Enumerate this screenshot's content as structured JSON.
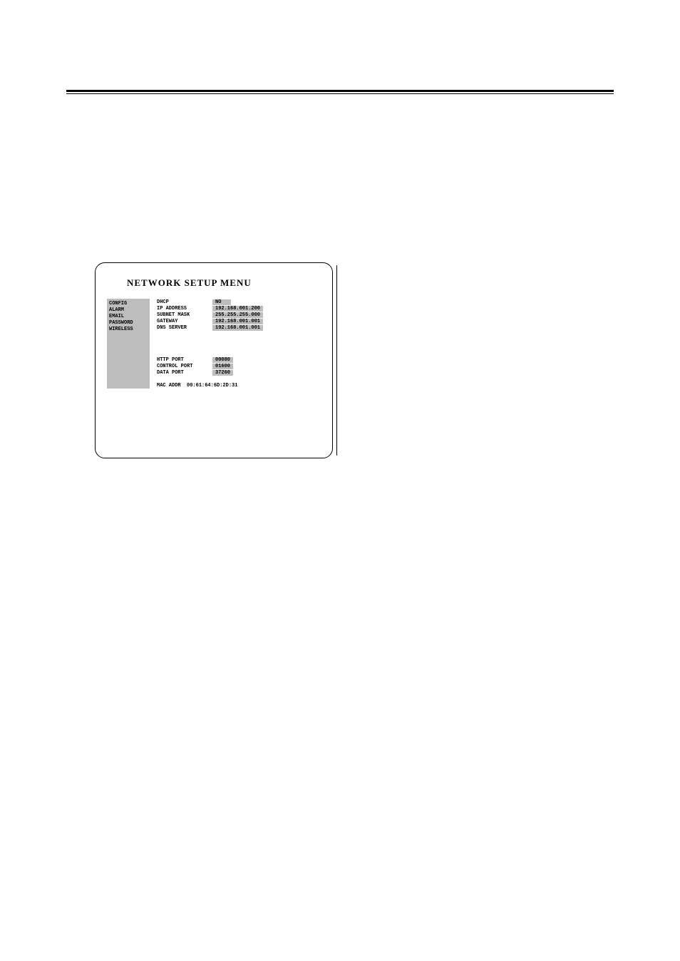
{
  "title": "NETWORK SETUP MENU",
  "sidebar": {
    "items": [
      {
        "label": "CONFIG"
      },
      {
        "label": "ALARM"
      },
      {
        "label": "EMAIL"
      },
      {
        "label": "PASSWORD"
      },
      {
        "label": "WIRELESS"
      }
    ]
  },
  "fields": {
    "dhcp": {
      "label": "DHCP",
      "value": "NO"
    },
    "ip": {
      "label": "IP ADDRESS",
      "value": "192.168.001.200"
    },
    "subnet": {
      "label": "SUBNET MASK",
      "value": "255.255.255.000"
    },
    "gateway": {
      "label": "GATEWAY",
      "value": "192.168.001.001"
    },
    "dns": {
      "label": "DNS SERVER",
      "value": "192.168.001.001"
    },
    "http": {
      "label": "HTTP PORT",
      "value": "00080"
    },
    "control": {
      "label": "CONTROL PORT",
      "value": "01600"
    },
    "data": {
      "label": "DATA PORT",
      "value": "37260"
    }
  },
  "mac": {
    "label": "MAC ADDR",
    "value": "00:61:64:6D:2D:31"
  }
}
